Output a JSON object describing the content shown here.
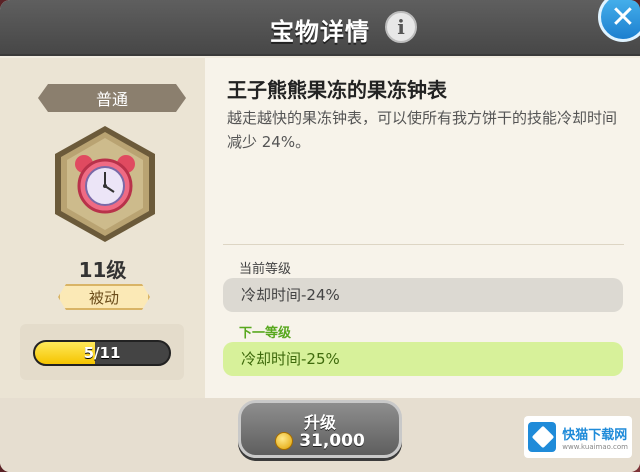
{
  "header": {
    "title": "宝物详情"
  },
  "treasure": {
    "rarity": "普通",
    "level": "11级",
    "type": "被动",
    "progress_text": "5/11",
    "progress_fraction": 0.45,
    "name": "王子熊熊果冻的果冻钟表",
    "description": "越走越快的果冻钟表，可以使所有我方饼干的技能冷却时间减少 24%。"
  },
  "levels": {
    "current_label": "当前等级",
    "current_effect": "冷却时间-24%",
    "next_label": "下一等级",
    "next_effect": "冷却时间-25%"
  },
  "upgrade": {
    "label": "升级",
    "cost": "31,000"
  },
  "watermark": {
    "name": "快猫下载网",
    "url": "www.kuaimao.com"
  },
  "colors": {
    "header_bg": "#4f4f4f",
    "close_button": "#2a95e0",
    "progress_fill": "#f5c400",
    "next_box": "#d7f19a"
  }
}
